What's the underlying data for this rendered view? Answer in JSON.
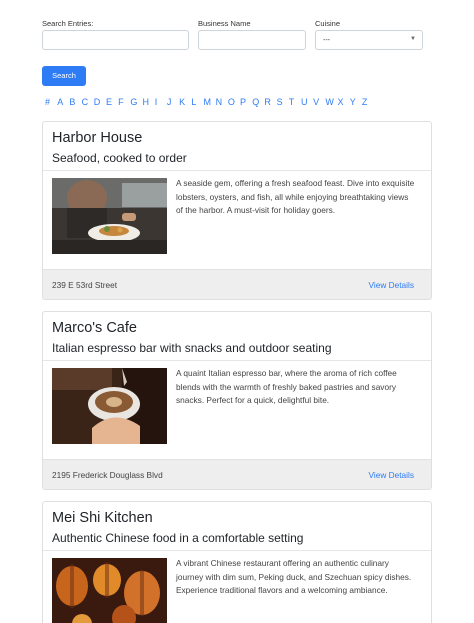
{
  "filters": {
    "search_label": "Search Entries:",
    "business_label": "Business Name",
    "cuisine_label": "Cuisine",
    "cuisine_selected": "---",
    "search_button": "Search"
  },
  "alphabet": [
    "#",
    "A",
    "B",
    "C",
    "D",
    "E",
    "F",
    "G",
    "H",
    "I",
    "J",
    "K",
    "L",
    "M",
    "N",
    "O",
    "P",
    "Q",
    "R",
    "S",
    "T",
    "U",
    "V",
    "W",
    "X",
    "Y",
    "Z"
  ],
  "cards": [
    {
      "title": "Harbor House",
      "subtitle": "Seafood, cooked to order",
      "description": "A seaside gem, offering a fresh seafood feast. Dive into exquisite lobsters, oysters, and fish, all while enjoying breathtaking views of the harbor. A must-visit for holiday goers.",
      "address": "239 E 53rd Street",
      "link": "View Details"
    },
    {
      "title": "Marco's Cafe",
      "subtitle": "Italian espresso bar with snacks and outdoor seating",
      "description": "A quaint Italian espresso bar, where the aroma of rich coffee blends with the warmth of freshly baked pastries and savory snacks. Perfect for a quick, delightful bite.",
      "address": "2195 Frederick Douglass Blvd",
      "link": "View Details"
    },
    {
      "title": "Mei Shi Kitchen",
      "subtitle": "Authentic Chinese food in a comfortable setting",
      "description": "A vibrant Chinese restaurant offering an authentic culinary journey with dim sum, Peking duck, and Szechuan spicy dishes. Experience traditional flavors and a welcoming ambiance.",
      "address": "",
      "link": ""
    }
  ]
}
